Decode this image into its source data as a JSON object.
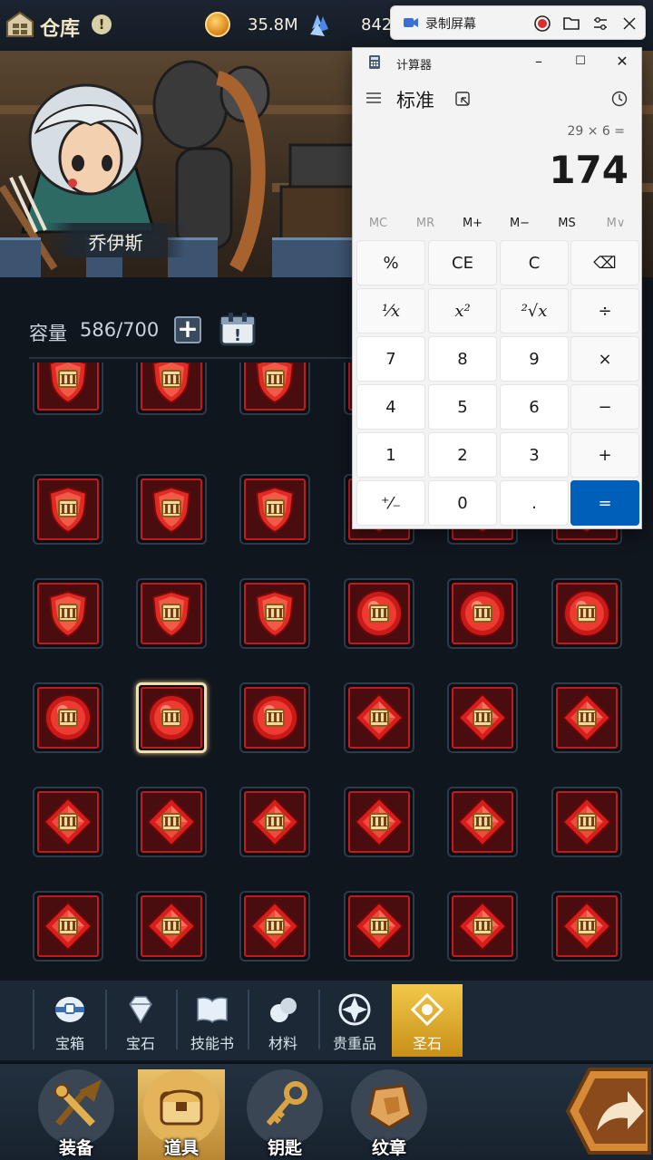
{
  "header": {
    "title": "仓库",
    "coin_value": "35.8M",
    "crystal_value": "842"
  },
  "character": {
    "name": "乔伊斯"
  },
  "capacity": {
    "label": "容量",
    "value": "586/700"
  },
  "grid": {
    "selected_index": 19,
    "rows": [
      [
        "shield",
        "shield",
        "shield",
        "shield",
        "shield",
        "shield"
      ],
      [
        "shield",
        "shield",
        "shield",
        "shield",
        "shield",
        "shield"
      ],
      [
        "shield",
        "shield",
        "shield",
        "orb",
        "orb",
        "orb"
      ],
      [
        "orb",
        "orb",
        "orb",
        "diamond",
        "diamond",
        "diamond"
      ],
      [
        "diamond",
        "diamond",
        "diamond",
        "diamond",
        "diamond",
        "diamond"
      ],
      [
        "diamond",
        "diamond",
        "diamond",
        "diamond",
        "diamond",
        "diamond"
      ]
    ],
    "gem_label": "III"
  },
  "categories": [
    {
      "label": "宝箱",
      "icon": "chest-icon"
    },
    {
      "label": "宝石",
      "icon": "gem-icon"
    },
    {
      "label": "技能书",
      "icon": "book-icon"
    },
    {
      "label": "材料",
      "icon": "material-icon"
    },
    {
      "label": "贵重品",
      "icon": "valuable-icon"
    },
    {
      "label": "圣石",
      "icon": "holy-stone-icon",
      "active": true
    }
  ],
  "nav": [
    {
      "label": "装备",
      "icon": "equipment-icon"
    },
    {
      "label": "道具",
      "icon": "items-icon",
      "active": true
    },
    {
      "label": "钥匙",
      "icon": "key-icon"
    },
    {
      "label": "纹章",
      "icon": "emblem-icon"
    }
  ],
  "recorder": {
    "title": "录制屏幕"
  },
  "calculator": {
    "title": "计算器",
    "mode": "标准",
    "expression": "29 × 6 =",
    "result": "174",
    "memory": [
      "MC",
      "MR",
      "M+",
      "M−",
      "MS",
      "M∨"
    ],
    "keys": [
      [
        "%",
        "CE",
        "C",
        "⌫"
      ],
      [
        "¹⁄x",
        "x²",
        "²√x",
        "÷"
      ],
      [
        "7",
        "8",
        "9",
        "×"
      ],
      [
        "4",
        "5",
        "6",
        "−"
      ],
      [
        "1",
        "2",
        "3",
        "+"
      ],
      [
        "⁺⁄₋",
        "0",
        ".",
        "="
      ]
    ]
  },
  "colors": {
    "gem_red": "#d3221f",
    "gold": "#f1c84a",
    "calc_accent": "#005fb8"
  }
}
